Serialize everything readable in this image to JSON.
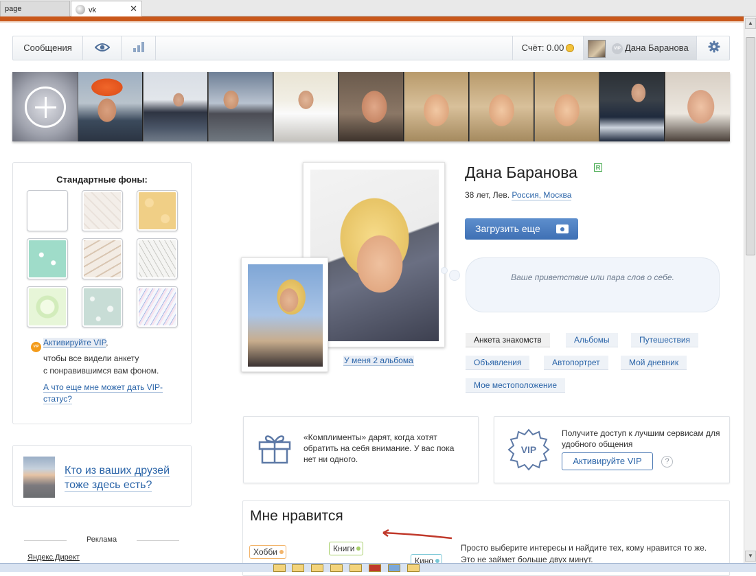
{
  "browser": {
    "tabs": [
      {
        "label": "page"
      },
      {
        "label": "vk"
      }
    ]
  },
  "toolbar": {
    "messages_label": "Сообщения",
    "score_label": "Счёт: 0.00",
    "user_name": "Дана Баранова",
    "vip_badge": "VIP"
  },
  "left": {
    "backgrounds_title": "Стандартные фоны:",
    "vip_badge": "VIP",
    "vip_link": "Активируйте VIP",
    "vip_comma": ",",
    "vip_text_1": "чтобы все видели анкету",
    "vip_text_2": "с понравившимся вам фоном.",
    "vip_more_link": "А что еще мне может дать VIP-статус?",
    "friends_text": "Кто из ваших друзей тоже здесь есть?",
    "ads_title": "Реклама",
    "ads_link": "Яндекс.Директ"
  },
  "profile": {
    "name": "Дана Баранова",
    "real_badge": "R",
    "meta_age": "38 лет, Лев.",
    "meta_location": "Россия, Москва",
    "upload_button": "Загрузить еще",
    "albums_link": "У меня 2 альбома",
    "greeting_placeholder": "Ваше приветствие или пара слов о себе.",
    "tags": [
      "Анкета знакомств",
      "Альбомы",
      "Путешествия",
      "Объявления",
      "Автопортрет",
      "Мой дневник",
      "Мое местоположение"
    ]
  },
  "cards": {
    "compliments_text": "«Комплименты» дарят, когда хотят обратить на себя внимание. У вас пока нет ни одного.",
    "vip_text": "Получите доступ к лучшим сервисам для удобного общения",
    "vip_button": "Активируйте VIP",
    "vip_seal": "VIP",
    "help": "?"
  },
  "likes": {
    "title": "Мне нравится",
    "interests": [
      "Хобби",
      "Книги",
      "Кино"
    ],
    "text": "Просто выберите интересы и найдите тех, кому нравится то же. Это не займет больше двух минут."
  },
  "colors": {
    "accent_orange": "#c9581b",
    "link_blue": "#2a64a8",
    "button_blue": "#4a7bbd"
  }
}
